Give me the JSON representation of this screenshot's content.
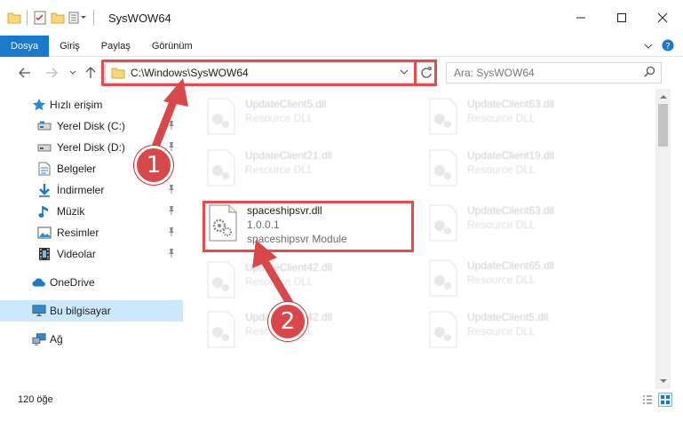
{
  "window": {
    "title": "SysWOW64",
    "minimize_icon": "minimize-icon",
    "maximize_icon": "maximize-icon",
    "close_icon": "close-icon"
  },
  "ribbon": {
    "tabs": [
      {
        "label": "Dosya",
        "active": true
      },
      {
        "label": "Giriş",
        "active": false
      },
      {
        "label": "Paylaş",
        "active": false
      },
      {
        "label": "Görünüm",
        "active": false
      }
    ]
  },
  "address": {
    "path": "C:\\Windows\\SysWOW64"
  },
  "search": {
    "placeholder": "Ara: SysWOW64"
  },
  "sidebar": {
    "quick_access": "Hızlı erişim",
    "items": [
      {
        "label": "Yerel Disk (C:)",
        "icon": "drive-icon",
        "pinned": true
      },
      {
        "label": "Yerel Disk (D:)",
        "icon": "drive-icon",
        "pinned": true
      },
      {
        "label": "Belgeler",
        "icon": "documents-icon",
        "pinned": true
      },
      {
        "label": "İndirmeler",
        "icon": "downloads-icon",
        "pinned": true
      },
      {
        "label": "Müzik",
        "icon": "music-icon",
        "pinned": true
      },
      {
        "label": "Resimler",
        "icon": "pictures-icon",
        "pinned": true
      },
      {
        "label": "Videolar",
        "icon": "videos-icon",
        "pinned": true
      }
    ],
    "onedrive": "OneDrive",
    "this_pc": "Bu bilgisayar",
    "network": "Ağ"
  },
  "files": {
    "left": [
      {
        "name": "UpdateClient5.dll",
        "sub1": "Resource DLL",
        "sub2": ""
      },
      {
        "name": "UpdateClient21.dll",
        "sub1": "Resource DLL",
        "sub2": ""
      },
      {
        "name": "spaceshipsvr.dll",
        "sub1": "1.0.0.1",
        "sub2": "spaceshipsvr Module"
      },
      {
        "name": "UpdateClient42.dll",
        "sub1": "Resource DLL",
        "sub2": ""
      },
      {
        "name": "UpdateClient42.dll",
        "sub1": "Resource DLL",
        "sub2": ""
      }
    ],
    "right": [
      {
        "name": "UpdateClient63.dll",
        "sub1": "Resource DLL"
      },
      {
        "name": "UpdateClient19.dll",
        "sub1": "Resource DLL"
      },
      {
        "name": "UpdateClient63.dll",
        "sub1": "Resource DLL"
      },
      {
        "name": "UpdateClient65.dll",
        "sub1": "Resource DLL"
      },
      {
        "name": "UpdateClient5.dll",
        "sub1": "Resource DLL"
      }
    ]
  },
  "status": {
    "count": "120 öğe"
  },
  "annotations": {
    "badge1": "1",
    "badge2": "2"
  },
  "colors": {
    "accent": "#1979ca",
    "highlight": "#e34b4e",
    "selection": "#cce8ff"
  }
}
